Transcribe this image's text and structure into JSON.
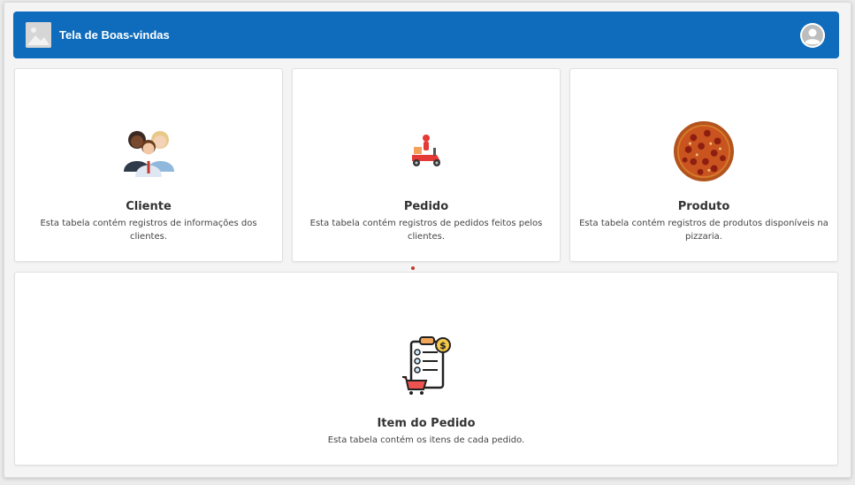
{
  "header": {
    "title": "Tela de Boas-vindas",
    "logo_icon": "image-placeholder-icon",
    "avatar_icon": "user-avatar-icon",
    "background_color": "#0f6cbd"
  },
  "cards": [
    {
      "title": "Cliente",
      "description": "Esta tabela contém registros de informações dos clientes.",
      "icon": "customers-group-icon"
    },
    {
      "title": "Pedido",
      "description": "Esta tabela contém registros de pedidos feitos pelos clientes.",
      "icon": "delivery-scooter-icon"
    },
    {
      "title": "Produto",
      "description": "Esta tabela contém registros de produtos disponíveis na pizzaria.",
      "icon": "pizza-icon"
    },
    {
      "title": "Item do Pedido",
      "description": "Esta tabela contém os itens de cada pedido.",
      "icon": "order-checklist-icon"
    }
  ]
}
